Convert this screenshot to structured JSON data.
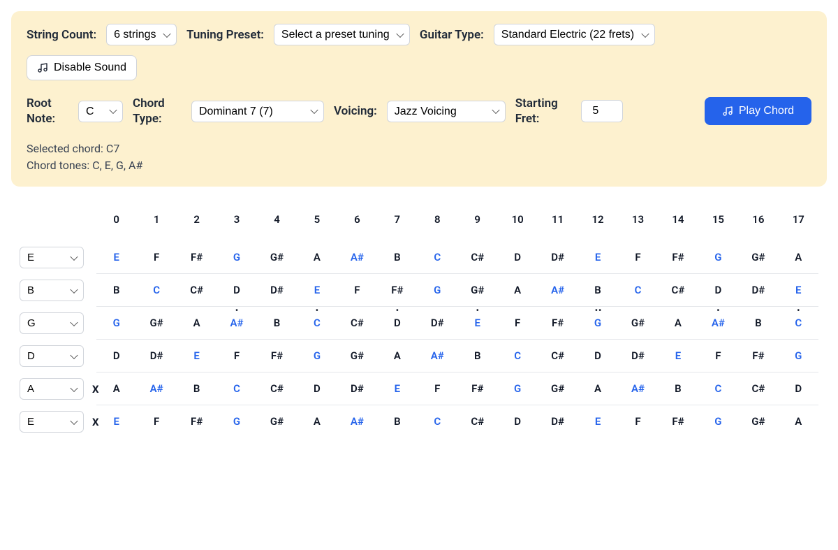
{
  "controls": {
    "string_count_label": "String Count:",
    "string_count_value": "6 strings",
    "tuning_preset_label": "Tuning Preset:",
    "tuning_preset_value": "Select a preset tuning",
    "guitar_type_label": "Guitar Type:",
    "guitar_type_value": "Standard Electric (22 frets)",
    "sound_toggle_label": "Disable Sound",
    "root_note_label": "Root Note:",
    "root_note_value": "C",
    "chord_type_label": "Chord Type:",
    "chord_type_value": "Dominant 7 (7)",
    "voicing_label": "Voicing:",
    "voicing_value": "Jazz Voicing",
    "starting_fret_label": "Starting Fret:",
    "starting_fret_value": "5",
    "play_chord_label": "Play Chord"
  },
  "info": {
    "selected_chord": "Selected chord: C7",
    "chord_tones": "Chord tones: C, E, G, A#"
  },
  "chord_tone_set": [
    "C",
    "E",
    "G",
    "A#"
  ],
  "fret_numbers": [
    "0",
    "1",
    "2",
    "3",
    "4",
    "5",
    "6",
    "7",
    "8",
    "9",
    "10",
    "11",
    "12",
    "13",
    "14",
    "15",
    "16",
    "17"
  ],
  "marker_dots": {
    "3": "single",
    "5": "single",
    "7": "single",
    "9": "single",
    "12": "double",
    "15": "single",
    "17": "single"
  },
  "strings": [
    {
      "open": "E",
      "muted": false,
      "notes": [
        "E",
        "F",
        "F#",
        "G",
        "G#",
        "A",
        "A#",
        "B",
        "C",
        "C#",
        "D",
        "D#",
        "E",
        "F",
        "F#",
        "G",
        "G#",
        "A"
      ]
    },
    {
      "open": "B",
      "muted": false,
      "notes": [
        "B",
        "C",
        "C#",
        "D",
        "D#",
        "E",
        "F",
        "F#",
        "G",
        "G#",
        "A",
        "A#",
        "B",
        "C",
        "C#",
        "D",
        "D#",
        "E"
      ]
    },
    {
      "open": "G",
      "muted": false,
      "notes": [
        "G",
        "G#",
        "A",
        "A#",
        "B",
        "C",
        "C#",
        "D",
        "D#",
        "E",
        "F",
        "F#",
        "G",
        "G#",
        "A",
        "A#",
        "B",
        "C"
      ]
    },
    {
      "open": "D",
      "muted": false,
      "notes": [
        "D",
        "D#",
        "E",
        "F",
        "F#",
        "G",
        "G#",
        "A",
        "A#",
        "B",
        "C",
        "C#",
        "D",
        "D#",
        "E",
        "F",
        "F#",
        "G"
      ]
    },
    {
      "open": "A",
      "muted": true,
      "notes": [
        "A",
        "A#",
        "B",
        "C",
        "C#",
        "D",
        "D#",
        "E",
        "F",
        "F#",
        "G",
        "G#",
        "A",
        "A#",
        "B",
        "C",
        "C#",
        "D"
      ]
    },
    {
      "open": "E",
      "muted": true,
      "notes": [
        "E",
        "F",
        "F#",
        "G",
        "G#",
        "A",
        "A#",
        "B",
        "C",
        "C#",
        "D",
        "D#",
        "E",
        "F",
        "F#",
        "G",
        "G#",
        "A"
      ]
    }
  ]
}
